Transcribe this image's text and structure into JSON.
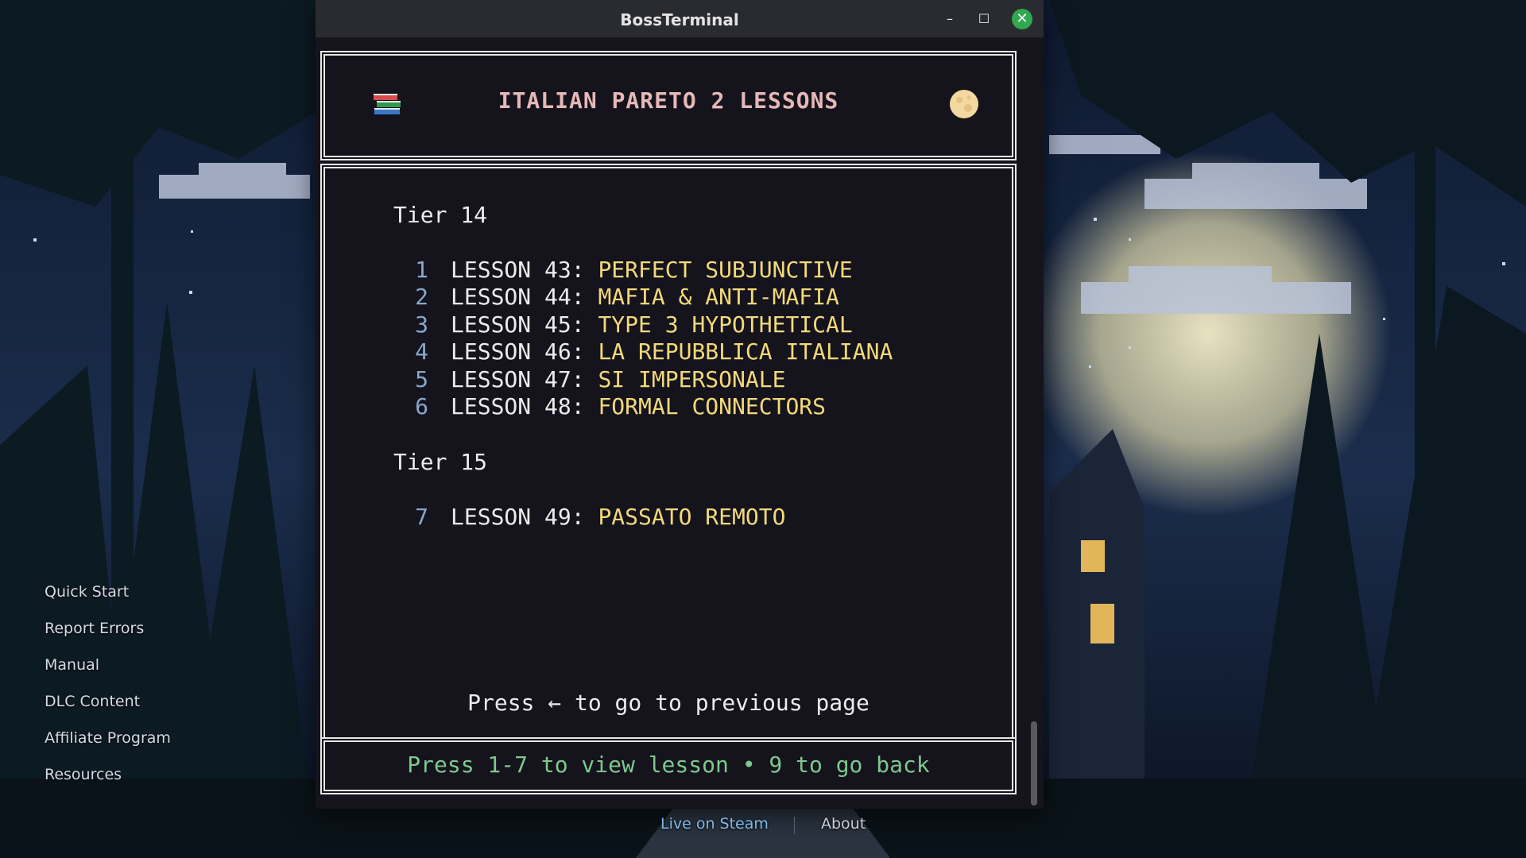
{
  "window": {
    "title": "BossTerminal",
    "minimize_glyph": "–",
    "maximize_glyph": "☐",
    "close_glyph": "✕"
  },
  "header": {
    "title": "ITALIAN PARETO 2 LESSONS",
    "left_icon": "books-icon",
    "right_icon": "moon-icon"
  },
  "tiers": [
    {
      "label": "Tier 14",
      "lessons": [
        {
          "num": "1",
          "label": "LESSON 43:",
          "title": "PERFECT SUBJUNCTIVE"
        },
        {
          "num": "2",
          "label": "LESSON 44:",
          "title": "MAFIA & ANTI-MAFIA"
        },
        {
          "num": "3",
          "label": "LESSON 45:",
          "title": "TYPE 3 HYPOTHETICAL"
        },
        {
          "num": "4",
          "label": "LESSON 46:",
          "title": "LA REPUBBLICA ITALIANA"
        },
        {
          "num": "5",
          "label": "LESSON 47:",
          "title": "SI IMPERSONALE"
        },
        {
          "num": "6",
          "label": "LESSON 48:",
          "title": "FORMAL CONNECTORS"
        }
      ]
    },
    {
      "label": "Tier 15",
      "lessons": [
        {
          "num": "7",
          "label": "LESSON 49:",
          "title": "PASSATO REMOTO"
        }
      ]
    }
  ],
  "prev_hint": "Press ← to go to previous page",
  "footer_hint": "Press 1-7 to view lesson • 9 to go back",
  "side_links": [
    "Quick Start",
    "Report Errors",
    "Manual",
    "DLC Content",
    "Affiliate Program",
    "Resources"
  ],
  "bottom": {
    "steam": "Live on Steam",
    "about": "About"
  },
  "colors": {
    "header_title": "#e6b8b8",
    "lesson_title": "#f2d97a",
    "lesson_number": "#88a8cc",
    "footer_hint": "#7cc98f",
    "close_button": "#2fa84f"
  }
}
